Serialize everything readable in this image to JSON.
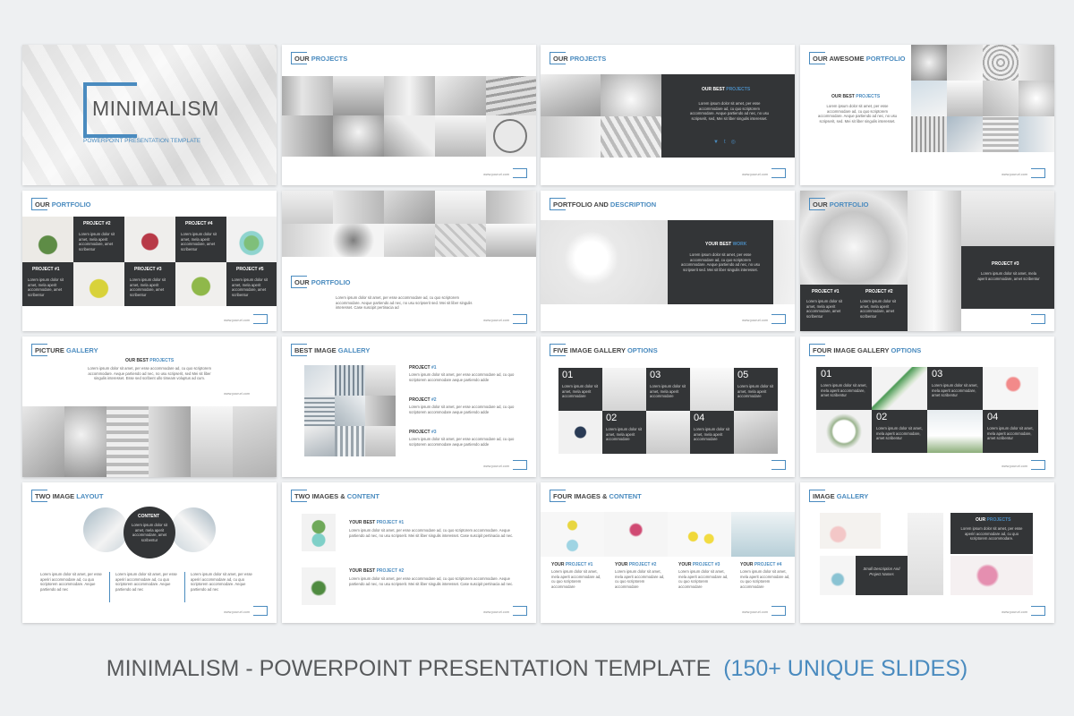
{
  "caption": {
    "main": "MINIMALISM - POWERPOINT PRESENTATION TEMPLATE",
    "accent": "(150+ UNIQUE SLIDES)"
  },
  "colors": {
    "accent": "#4a8bbf",
    "dark_panel": "#333537",
    "background": "#eef0f2"
  },
  "lorem": "Lorem ipsum dolor sit amet, per esse accommodare ad, cu quo scriptorem accommodare. Aeque partiendo ad nec, no usu gilis seceris mediocritatem. Ibo sit liber scriptorum",
  "lorem_short": "Lorem ipsum dolor sit amet, mela aperit accommodare",
  "url": "www.yoururl.com",
  "s1": {
    "title": "MINIMALISM",
    "subtitle": "POWERPOINT PRESENTATION TEMPLATE"
  },
  "s2": {
    "t1": "OUR",
    "t2": "PROJECTS"
  },
  "s3": {
    "t1": "OUR",
    "t2": "PROJECTS",
    "h1": "OUR BEST",
    "h2": "PROJECTS",
    "text": "Lorem ipsum dolor sit amet, per esse accommodare ad, cu quo scriptorem accommodare. Aeque partiendo ad nec, no usu scripserit, sed, Mei sit liber singulis interesset."
  },
  "s4": {
    "t1": "OUR AWESOME",
    "t2": "PORTFOLIO",
    "h1": "OUR BEST",
    "h2": "PROJECTS",
    "text": "Lorem ipsum dolor sit amet, per esse accommodare ad, cu quo scriptorem accommodare. Aeque partiendo ad nec, no usu scripserit, sed. Mei sit liber singulis interesset."
  },
  "s5": {
    "t1": "OUR",
    "t2": "PORTFOLIO",
    "p1": "PROJECT #1",
    "p2": "PROJECT #2",
    "p3": "PROJECT #3",
    "p4": "PROJECT #4",
    "p5": "PROJECT #5",
    "text": "Lorem ipsum dolor sit amet, mela aperit accommodare, amet scribentur"
  },
  "s6": {
    "t1": "OUR",
    "t2": "PORTFOLIO",
    "text": "Lorem ipsum dolor sit amet, per esse accommodare ad, cu quo scriptorem accommodare. Aeque partiendo ad nec, no usu scripserit sed. Mei sit liber singulis interesset. Case suscipit pertinacia ad"
  },
  "s7": {
    "t1": "PORTFOLIO AND",
    "t2": "DESCRIPTION",
    "h1": "YOUR BEST",
    "h2": "WORK",
    "text": "Lorem ipsum dolor sit amet, per esse accommodare ad, cu quo scriptorem accommodare. Aeque partiendo ad nec, no usu scripserit sed. Mei sit liber singulis interesset."
  },
  "s8": {
    "t1": "OUR",
    "t2": "PORTFOLIO",
    "p1": "PROJECT #1",
    "p2": "PROJECT #2",
    "p3": "PROJECT #3",
    "text": "Lorem ipsum dolor sit amet, mela aperit accommodare, amet scribentur"
  },
  "s9": {
    "t1": "PICTURE",
    "t2": "GALLERY",
    "h1": "OUR BEST",
    "h2": "PROJECTS",
    "text": "Lorem ipsum dolor sit amet, per esse accommodare ad, cu quo scriptorem accommodare. Aeque partiendo ad nec, no usu scripserit, sed Mei sit liber singulis interesset. Esse sed scribent ullo timeam voluptus ad cum."
  },
  "s10": {
    "t1": "BEST IMAGE",
    "t2": "GALLERY",
    "p1a": "PROJECT",
    "p1b": "#1",
    "p2a": "PROJECT",
    "p2b": "#2",
    "p3a": "PROJECT",
    "p3b": "#3",
    "text": "Lorem ipsum dolor sit amet, per esse accommodare ad, cu quo scriptorem accommodare aeque partiendo adde"
  },
  "s11": {
    "t1": "FIVE IMAGE GALLERY",
    "t2": "OPTIONS",
    "n1": "01",
    "n2": "02",
    "n3": "03",
    "n4": "04",
    "n5": "05",
    "text": "Lorem ipsum dolor sit amet, mela aperit accommodare"
  },
  "s12": {
    "t1": "FOUR IMAGE GALLERY",
    "t2": "OPTIONS",
    "n1": "01",
    "n2": "02",
    "n3": "03",
    "n4": "04",
    "text": "Lorem ipsum dolor sit amet, mela aperit accommodare, amet scribentur"
  },
  "s13": {
    "t1": "TWO IMAGE",
    "t2": "LAYOUT",
    "content": "CONTENT",
    "ctext": "Lorem ipsum dolor sit amet, mela aperit accommodare, amet scribentur",
    "text": "Lorem ipsum dolor sit amet, per esse aperiri accommodare ad, cu quo scriptorem accommodare. Aeque partiendo ad nec"
  },
  "s14": {
    "t1": "TWO IMAGES &",
    "t2": "CONTENT",
    "p1a": "YOUR BEST",
    "p1b": "PROJECT #1",
    "p2a": "YOUR BEST",
    "p2b": "PROJECT #2",
    "text": "Lorem ipsum dolor sit amet, per esse accommodare ad, cu quo scriptorem accommodare. Aeque partiendo ad nec, no usu scripserit. Mei sit liber singulis interesset. Case suscipit pertinacia ad nec."
  },
  "s15": {
    "t1": "FOUR IMAGES &",
    "t2": "CONTENT",
    "y": "YOUR",
    "p1": "PROJECT #1",
    "p2": "PROJECT #2",
    "p3": "PROJECT #3",
    "p4": "PROJECT #4",
    "text": "Lorem ipsum dolor sit amet, mela aperit accommodare ad, cu quo scriptorem accommodare"
  },
  "s16": {
    "t1": "IMAGE",
    "t2": "GALLERY",
    "h1": "OUR",
    "h2": "PROJECTS",
    "text": "Lorem ipsum dolor sit amet, per esse aperiri accommodare ad, cu quo scriptorem accommodare.",
    "small": "Small Description And Project Names"
  }
}
